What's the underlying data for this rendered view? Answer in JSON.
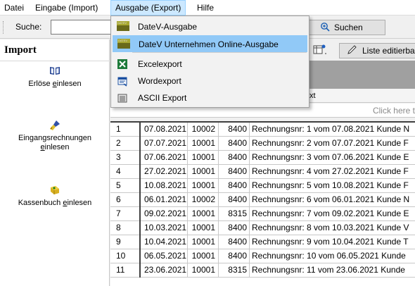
{
  "menubar": {
    "items": [
      {
        "label": "Datei"
      },
      {
        "label": "Eingabe (Import)"
      },
      {
        "label": "Ausgabe (Export)"
      },
      {
        "label": "Hilfe"
      }
    ]
  },
  "toolbar": {
    "search_label": "Suche:",
    "search_value": "",
    "search_button": "Suchen",
    "liste_button": "Liste editierbar"
  },
  "leftpanel": {
    "title": "Import",
    "entries": [
      {
        "label_pre": "Erl",
        "label_mid": "ö",
        "label_post": "se ",
        "label_ul": "e",
        "label_rest": "inlesen",
        "icon": "book-icon"
      },
      {
        "line1": "Eingangsrechnungen",
        "line2_ul": "e",
        "line2_rest": "inlesen",
        "icon": "brush-icon"
      },
      {
        "label_pre": "Kassenbuch ",
        "label_ul": "e",
        "label_rest": "inlesen",
        "icon": "cashbox-icon"
      }
    ]
  },
  "dropdown": {
    "items": [
      {
        "label": "DateV-Ausgabe",
        "icon": "datev-icon"
      },
      {
        "label": "DateV Unternehmen Online-Ausgabe",
        "icon": "datev-icon"
      },
      {
        "label": "Excelexport",
        "icon": "excel-icon"
      },
      {
        "label": "Wordexport",
        "icon": "word-icon"
      },
      {
        "label": "ASCII Export",
        "icon": "ascii-icon"
      }
    ]
  },
  "grid": {
    "partial_header": "xt",
    "click_hint": "Click here t",
    "rows": [
      {
        "idx": "1",
        "date": "07.08.2021",
        "num": "10002",
        "acc": "8400",
        "text": "Rechnungsnr: 1 vom 07.08.2021 Kunde N"
      },
      {
        "idx": "2",
        "date": "07.07.2021",
        "num": "10001",
        "acc": "8400",
        "text": "Rechnungsnr: 2 vom 07.07.2021 Kunde F"
      },
      {
        "idx": "3",
        "date": "07.06.2021",
        "num": "10001",
        "acc": "8400",
        "text": "Rechnungsnr: 3 vom 07.06.2021 Kunde E"
      },
      {
        "idx": "4",
        "date": "27.02.2021",
        "num": "10001",
        "acc": "8400",
        "text": "Rechnungsnr: 4 vom 27.02.2021 Kunde F"
      },
      {
        "idx": "5",
        "date": "10.08.2021",
        "num": "10001",
        "acc": "8400",
        "text": "Rechnungsnr: 5 vom 10.08.2021 Kunde F"
      },
      {
        "idx": "6",
        "date": "06.01.2021",
        "num": "10002",
        "acc": "8400",
        "text": "Rechnungsnr: 6 vom 06.01.2021 Kunde N"
      },
      {
        "idx": "7",
        "date": "09.02.2021",
        "num": "10001",
        "acc": "8315",
        "text": "Rechnungsnr: 7 vom 09.02.2021 Kunde E"
      },
      {
        "idx": "8",
        "date": "10.03.2021",
        "num": "10001",
        "acc": "8400",
        "text": "Rechnungsnr: 8 vom 10.03.2021 Kunde V"
      },
      {
        "idx": "9",
        "date": "10.04.2021",
        "num": "10001",
        "acc": "8400",
        "text": "Rechnungsnr: 9 vom 10.04.2021 Kunde T"
      },
      {
        "idx": "10",
        "date": "06.05.2021",
        "num": "10001",
        "acc": "8400",
        "text": "Rechnungsnr: 10 vom 06.05.2021 Kunde"
      },
      {
        "idx": "11",
        "date": "23.06.2021",
        "num": "10001",
        "acc": "8315",
        "text": "Rechnungsnr: 11 vom 23.06.2021 Kunde"
      }
    ]
  },
  "colors": {
    "menu_active_bg": "#cce8ff",
    "dropdown_highlight": "#91c9f7",
    "grid_header_bg": "#a0a0a0"
  }
}
